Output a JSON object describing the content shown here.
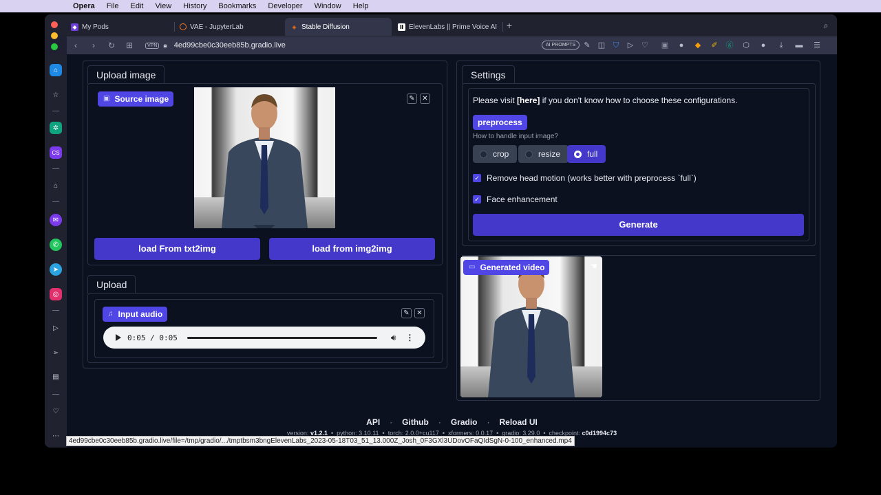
{
  "menubar": {
    "app": "Opera",
    "items": [
      "File",
      "Edit",
      "View",
      "History",
      "Bookmarks",
      "Developer",
      "Window",
      "Help"
    ]
  },
  "tabs": [
    {
      "label": "My Pods",
      "icon": "runpod-icon"
    },
    {
      "label": "VAE - JupyterLab",
      "icon": "jupyter-icon"
    },
    {
      "label": "Stable Diffusion",
      "icon": "gradio-icon",
      "active": true
    },
    {
      "label": "ElevenLabs || Prime Voice AI",
      "icon": "elevenlabs-icon"
    }
  ],
  "address": {
    "vpn": "VPN",
    "url_prefix": "4ed99cbe0c30eeb85b.",
    "url_host": "gradio.live",
    "ai_prompts": "AI PROMPTS"
  },
  "upload_image": {
    "tab": "Upload image",
    "badge": "Source image",
    "btn_txt2img": "load From txt2img",
    "btn_img2img": "load from img2img"
  },
  "upload_audio": {
    "tab": "Upload",
    "badge": "Input audio",
    "time": "0:05 / 0:05",
    "progress": 1.0
  },
  "settings": {
    "tab": "Settings",
    "visit_pre": "Please visit ",
    "visit_link": "[here]",
    "visit_post": " if you don't know how to choose these configurations.",
    "preprocess_badge": "preprocess",
    "preprocess_question": "How to handle input image?",
    "options": [
      "crop",
      "resize",
      "full"
    ],
    "selected": "full",
    "remove_head_motion": "Remove head motion (works better with preprocess `full`)",
    "face_enhancement": "Face enhancement",
    "generate": "Generate"
  },
  "generated": {
    "badge": "Generated video"
  },
  "footer": {
    "links": [
      "API",
      "Github",
      "Gradio",
      "Reload UI"
    ],
    "sep": "·",
    "meta": [
      {
        "label": "version:",
        "value": "v1.2.1"
      },
      {
        "label": "python:",
        "value": "3.10.11"
      },
      {
        "label": "torch:",
        "value": "2.0.0+cu117"
      },
      {
        "label": "xformers:",
        "value": "0.0.17"
      },
      {
        "label": "gradio:",
        "value": "3.29.0"
      },
      {
        "label": "checkpoint:",
        "value": "c0d1994c73"
      }
    ]
  },
  "statusbar": "4ed99cbe0c30eeb85b.gradio.live/file=/tmp/gradio/.../tmptbsm3bngElevenLabs_2023-05-18T03_51_13.000Z_Josh_0F3GXl3UDovOFaQIdSgN-0-100_enhanced.mp4",
  "colors": {
    "accent": "#4f46e5",
    "button": "#4338ca",
    "page_bg": "#0c111f"
  }
}
